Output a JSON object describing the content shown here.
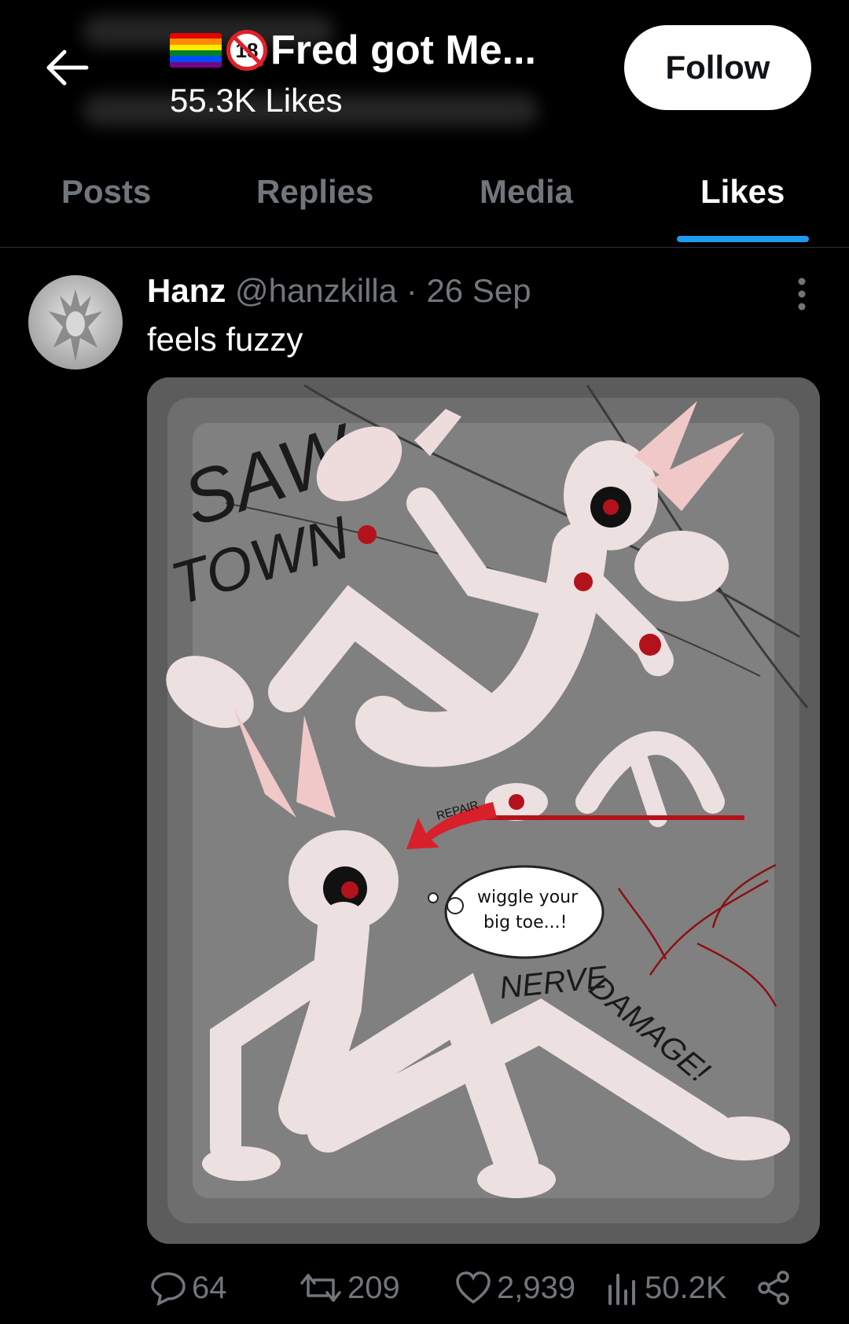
{
  "profile": {
    "title": "Fred got Me...",
    "subtitle": "55.3K Likes",
    "follow_label": "Follow"
  },
  "tabs": [
    {
      "label": "Posts"
    },
    {
      "label": "Replies"
    },
    {
      "label": "Media"
    },
    {
      "label": "Likes",
      "active": true
    }
  ],
  "post": {
    "author_name": "Hanz",
    "handle": "@hanzkilla",
    "separator": "·",
    "date": "26 Sep",
    "text": "feels fuzzy",
    "image_text": {
      "saw_town_1": "SAW",
      "saw_town_2": "TOWN",
      "repair": "REPAIR",
      "bubble_1": "wiggle your",
      "bubble_2": "big toe...!",
      "nerve": "NERVE",
      "damage": "DAMAGE!"
    },
    "stats": {
      "replies": "64",
      "reposts": "209",
      "likes": "2,939",
      "views": "50.2K"
    }
  },
  "colors": {
    "accent": "#1d9bf0",
    "muted": "#71767b",
    "blood": "#b3121c"
  },
  "icons": {
    "back": "arrow-left-icon",
    "no18": "no-under-18-icon",
    "flag": "rainbow-flag-icon",
    "more": "more-vertical-icon",
    "reply": "reply-icon",
    "repost": "repost-icon",
    "like": "heart-icon",
    "views": "views-icon",
    "share": "share-icon"
  }
}
